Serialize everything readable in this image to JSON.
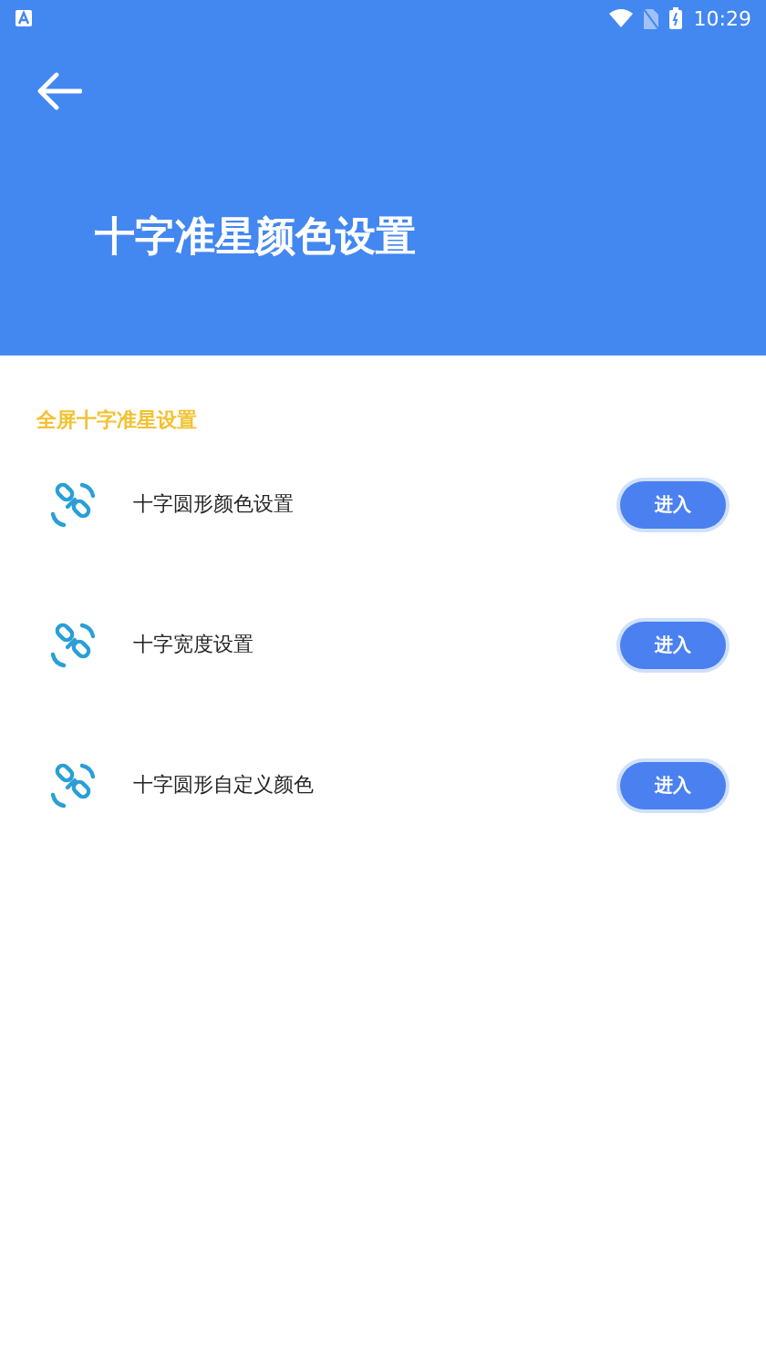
{
  "status_bar": {
    "time": "10:29"
  },
  "header": {
    "title": "十字准星颜色设置"
  },
  "section": {
    "title": "全屏十字准星设置"
  },
  "items": [
    {
      "label": "十字圆形颜色设置",
      "button": "进入"
    },
    {
      "label": "十字宽度设置",
      "button": "进入"
    },
    {
      "label": "十字圆形自定义颜色",
      "button": "进入"
    }
  ]
}
